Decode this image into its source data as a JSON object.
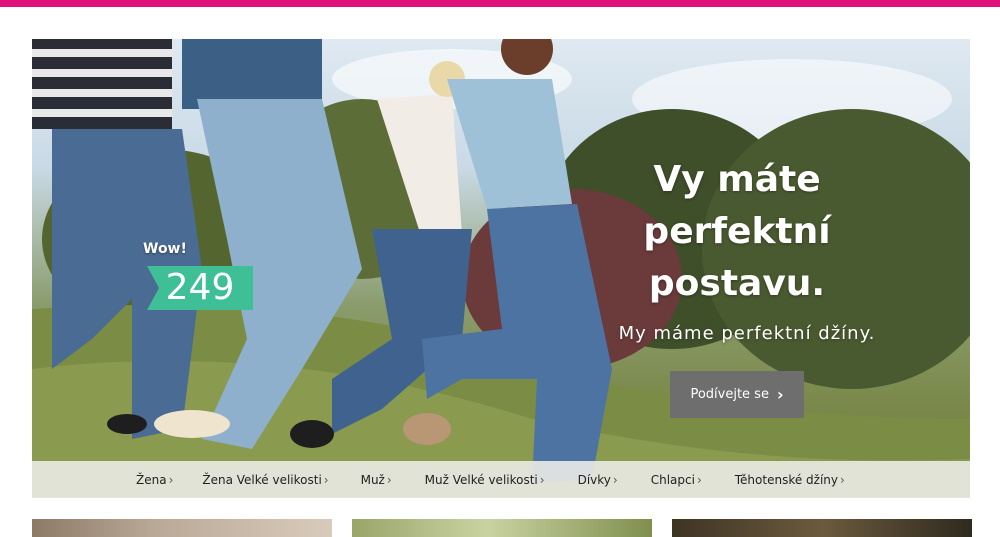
{
  "hero": {
    "headline": [
      "Vy máte",
      "perfektní",
      "postavu."
    ],
    "subheadline": "My máme perfektní džíny.",
    "cta_label": "Podívejte se",
    "promo": {
      "wow_label": "Wow!",
      "count": "249"
    }
  },
  "categories": [
    "Žena",
    "Žena Velké velikosti",
    "Muž",
    "Muž Velké velikosti",
    "Dívky",
    "Chlapci",
    "Těhotenské džíny"
  ],
  "colors": {
    "brand_bar": "#e0117a",
    "badge": "#3fbf96",
    "cta_bg": "#6e6e6e",
    "nav_bg": "#ebebe6"
  }
}
